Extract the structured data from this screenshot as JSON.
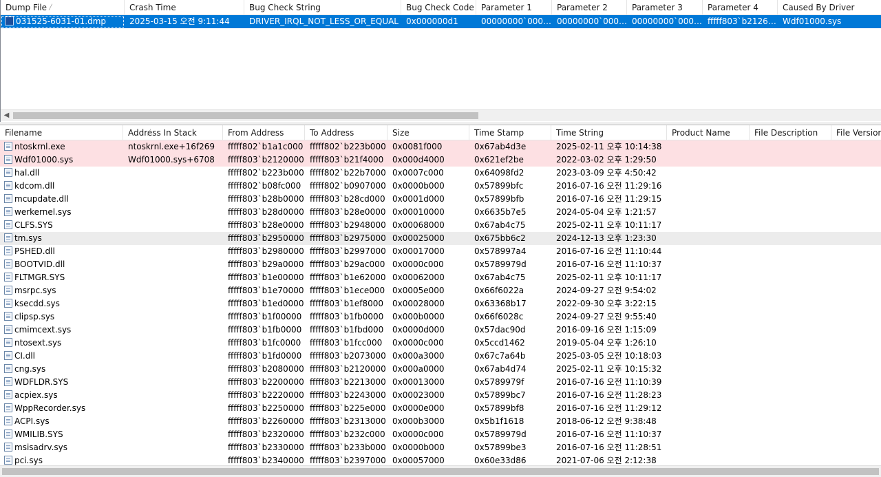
{
  "top_table": {
    "columns": [
      {
        "label": "Dump File",
        "w": 180,
        "sort": "asc"
      },
      {
        "label": "Crash Time",
        "w": 174
      },
      {
        "label": "Bug Check String",
        "w": 228
      },
      {
        "label": "Bug Check Code",
        "w": 109
      },
      {
        "label": "Parameter 1",
        "w": 110
      },
      {
        "label": "Parameter 2",
        "w": 109
      },
      {
        "label": "Parameter 3",
        "w": 110
      },
      {
        "label": "Parameter 4",
        "w": 109
      },
      {
        "label": "Caused By Driver",
        "w": 151
      }
    ],
    "rows": [
      [
        "031525-6031-01.dmp",
        "2025-03-15 오전 9:11:44",
        "DRIVER_IRQL_NOT_LESS_OR_EQUAL",
        "0x000000d1",
        "00000000`0000...",
        "00000000`0000...",
        "00000000`0000...",
        "fffff803`b21267...",
        "Wdf01000.sys"
      ]
    ]
  },
  "bottom_table": {
    "columns": [
      {
        "label": "Filename",
        "w": 179
      },
      {
        "label": "Address In Stack",
        "w": 145,
        "sort": "asc"
      },
      {
        "label": "From Address",
        "w": 119
      },
      {
        "label": "To Address",
        "w": 120
      },
      {
        "label": "Size",
        "w": 119
      },
      {
        "label": "Time Stamp",
        "w": 119
      },
      {
        "label": "Time String",
        "w": 168
      },
      {
        "label": "Product Name",
        "w": 120
      },
      {
        "label": "File Description",
        "w": 119
      },
      {
        "label": "File Version",
        "w": 92
      }
    ],
    "rows": [
      [
        "ntoskrnl.exe",
        "ntoskrnl.exe+16f269",
        "fffff802`b1a1c000",
        "fffff802`b223b000",
        "0x0081f000",
        "0x67ab4d3e",
        "2025-02-11 오후 10:14:38",
        "",
        "",
        ""
      ],
      [
        "Wdf01000.sys",
        "Wdf01000.sys+6708",
        "fffff803`b2120000",
        "fffff803`b21f4000",
        "0x000d4000",
        "0x621ef2be",
        "2022-03-02 오후 1:29:50",
        "",
        "",
        ""
      ],
      [
        "hal.dll",
        "",
        "fffff802`b223b000",
        "fffff802`b22b7000",
        "0x0007c000",
        "0x64098fd2",
        "2023-03-09 오후 4:50:42",
        "",
        "",
        ""
      ],
      [
        "kdcom.dll",
        "",
        "fffff802`b08fc000",
        "fffff802`b0907000",
        "0x0000b000",
        "0x57899bfc",
        "2016-07-16 오전 11:29:16",
        "",
        "",
        ""
      ],
      [
        "mcupdate.dll",
        "",
        "fffff803`b28b0000",
        "fffff803`b28cd000",
        "0x0001d000",
        "0x57899bfb",
        "2016-07-16 오전 11:29:15",
        "",
        "",
        ""
      ],
      [
        "werkernel.sys",
        "",
        "fffff803`b28d0000",
        "fffff803`b28e0000",
        "0x00010000",
        "0x6635b7e5",
        "2024-05-04 오후 1:21:57",
        "",
        "",
        ""
      ],
      [
        "CLFS.SYS",
        "",
        "fffff803`b28e0000",
        "fffff803`b2948000",
        "0x00068000",
        "0x67ab4c75",
        "2025-02-11 오후 10:11:17",
        "",
        "",
        ""
      ],
      [
        "tm.sys",
        "",
        "fffff803`b2950000",
        "fffff803`b2975000",
        "0x00025000",
        "0x675bb6c2",
        "2024-12-13 오후 1:23:30",
        "",
        "",
        ""
      ],
      [
        "PSHED.dll",
        "",
        "fffff803`b2980000",
        "fffff803`b2997000",
        "0x00017000",
        "0x578997a4",
        "2016-07-16 오전 11:10:44",
        "",
        "",
        ""
      ],
      [
        "BOOTVID.dll",
        "",
        "fffff803`b29a0000",
        "fffff803`b29ac000",
        "0x0000c000",
        "0x5789979d",
        "2016-07-16 오전 11:10:37",
        "",
        "",
        ""
      ],
      [
        "FLTMGR.SYS",
        "",
        "fffff803`b1e00000",
        "fffff803`b1e62000",
        "0x00062000",
        "0x67ab4c75",
        "2025-02-11 오후 10:11:17",
        "",
        "",
        ""
      ],
      [
        "msrpc.sys",
        "",
        "fffff803`b1e70000",
        "fffff803`b1ece000",
        "0x0005e000",
        "0x66f6022a",
        "2024-09-27 오전 9:54:02",
        "",
        "",
        ""
      ],
      [
        "ksecdd.sys",
        "",
        "fffff803`b1ed0000",
        "fffff803`b1ef8000",
        "0x00028000",
        "0x63368b17",
        "2022-09-30 오후 3:22:15",
        "",
        "",
        ""
      ],
      [
        "clipsp.sys",
        "",
        "fffff803`b1f00000",
        "fffff803`b1fb0000",
        "0x000b0000",
        "0x66f6028c",
        "2024-09-27 오전 9:55:40",
        "",
        "",
        ""
      ],
      [
        "cmimcext.sys",
        "",
        "fffff803`b1fb0000",
        "fffff803`b1fbd000",
        "0x0000d000",
        "0x57dac90d",
        "2016-09-16 오전 1:15:09",
        "",
        "",
        ""
      ],
      [
        "ntosext.sys",
        "",
        "fffff803`b1fc0000",
        "fffff803`b1fcc000",
        "0x0000c000",
        "0x5ccd1462",
        "2019-05-04 오후 1:26:10",
        "",
        "",
        ""
      ],
      [
        "CI.dll",
        "",
        "fffff803`b1fd0000",
        "fffff803`b2073000",
        "0x000a3000",
        "0x67c7a64b",
        "2025-03-05 오전 10:18:03",
        "",
        "",
        ""
      ],
      [
        "cng.sys",
        "",
        "fffff803`b2080000",
        "fffff803`b2120000",
        "0x000a0000",
        "0x67ab4d74",
        "2025-02-11 오후 10:15:32",
        "",
        "",
        ""
      ],
      [
        "WDFLDR.SYS",
        "",
        "fffff803`b2200000",
        "fffff803`b2213000",
        "0x00013000",
        "0x5789979f",
        "2016-07-16 오전 11:10:39",
        "",
        "",
        ""
      ],
      [
        "acpiex.sys",
        "",
        "fffff803`b2220000",
        "fffff803`b2243000",
        "0x00023000",
        "0x57899bc7",
        "2016-07-16 오전 11:28:23",
        "",
        "",
        ""
      ],
      [
        "WppRecorder.sys",
        "",
        "fffff803`b2250000",
        "fffff803`b225e000",
        "0x0000e000",
        "0x57899bf8",
        "2016-07-16 오전 11:29:12",
        "",
        "",
        ""
      ],
      [
        "ACPI.sys",
        "",
        "fffff803`b2260000",
        "fffff803`b2313000",
        "0x000b3000",
        "0x5b1f1618",
        "2018-06-12 오전 9:38:48",
        "",
        "",
        ""
      ],
      [
        "WMILIB.SYS",
        "",
        "fffff803`b2320000",
        "fffff803`b232c000",
        "0x0000c000",
        "0x5789979d",
        "2016-07-16 오전 11:10:37",
        "",
        "",
        ""
      ],
      [
        "msisadrv.sys",
        "",
        "fffff803`b2330000",
        "fffff803`b233b000",
        "0x0000b000",
        "0x57899be3",
        "2016-07-16 오전 11:28:51",
        "",
        "",
        ""
      ],
      [
        "pci.sys",
        "",
        "fffff803`b2340000",
        "fffff803`b2397000",
        "0x00057000",
        "0x60e33d86",
        "2021-07-06 오전 2:12:38",
        "",
        "",
        ""
      ]
    ]
  },
  "colors": {
    "selected": "#0078d7",
    "highlight": "#fde0e3",
    "hover": "#ececec"
  },
  "icons": {
    "dump_file": "dump-file-icon",
    "module": "module-file-icon"
  }
}
